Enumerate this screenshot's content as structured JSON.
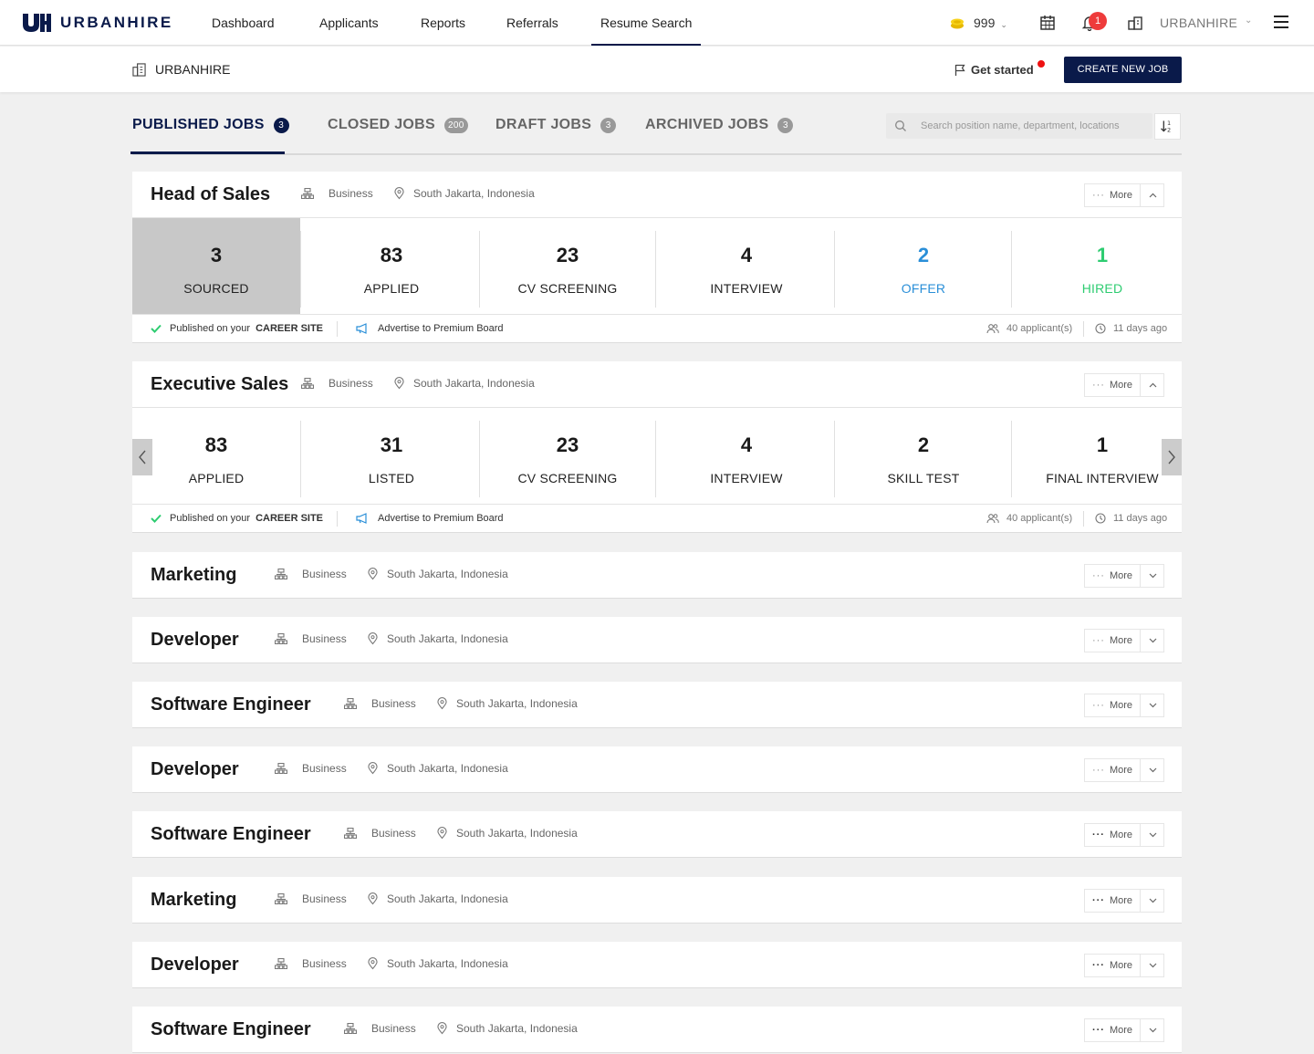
{
  "brand": {
    "name": "URBANHIRE",
    "accent": "#0a1a4a",
    "success": "#2ecc71",
    "offer": "#2a8fd8"
  },
  "nav": {
    "items": [
      {
        "label": "Dashboard"
      },
      {
        "label": "Applicants"
      },
      {
        "label": "Reports"
      },
      {
        "label": "Referrals"
      },
      {
        "label": "Resume Search"
      }
    ],
    "active": "Resume Search",
    "credits": "999",
    "notifications": "1",
    "company": "URBANHIRE"
  },
  "subheader": {
    "company": "URBANHIRE",
    "get_started": "Get started",
    "create_job": "CREATE NEW JOB"
  },
  "tabs": [
    {
      "label": "PUBLISHED JOBS",
      "count": "3"
    },
    {
      "label": "CLOSED JOBS",
      "count": "200"
    },
    {
      "label": "DRAFT JOBS",
      "count": "3"
    },
    {
      "label": "ARCHIVED JOBS",
      "count": "3"
    }
  ],
  "search": {
    "placeholder": "Search position name, department, locations",
    "value": ""
  },
  "footer_labels": {
    "published_on": "Published on your",
    "career_site": "CAREER SITE",
    "advertise": "Advertise to Premium Board"
  },
  "jobs": [
    {
      "title": "Head of Sales",
      "department": "Business",
      "location": "South Jakarta, Indonesia",
      "more": "More",
      "expanded": true,
      "stages": [
        {
          "count": "3",
          "label": "SOURCED"
        },
        {
          "count": "83",
          "label": "APPLIED"
        },
        {
          "count": "23",
          "label": "CV SCREENING"
        },
        {
          "count": "4",
          "label": "INTERVIEW"
        },
        {
          "count": "2",
          "label": "OFFER"
        },
        {
          "count": "1",
          "label": "HIRED"
        }
      ],
      "applicants": "40 applicant(s)",
      "posted": "11 days ago"
    },
    {
      "title": "Executive Sales",
      "department": "Business",
      "location": "South Jakarta, Indonesia",
      "more": "More",
      "expanded": true,
      "stages": [
        {
          "count": "83",
          "label": "APPLIED"
        },
        {
          "count": "31",
          "label": "LISTED"
        },
        {
          "count": "23",
          "label": "CV SCREENING"
        },
        {
          "count": "4",
          "label": "INTERVIEW"
        },
        {
          "count": "2",
          "label": "SKILL TEST"
        },
        {
          "count": "1",
          "label": "FINAL INTERVIEW"
        }
      ],
      "applicants": "40 applicant(s)",
      "posted": "11 days ago"
    },
    {
      "title": "Marketing",
      "department": "Business",
      "location": "South Jakarta, Indonesia",
      "more": "More"
    },
    {
      "title": "Developer",
      "department": "Business",
      "location": "South Jakarta, Indonesia",
      "more": "More"
    },
    {
      "title": "Software Engineer",
      "department": "Business",
      "location": "South Jakarta, Indonesia",
      "more": "More"
    },
    {
      "title": "Developer",
      "department": "Business",
      "location": "South Jakarta, Indonesia",
      "more": "More"
    },
    {
      "title": "Software Engineer",
      "department": "Business",
      "location": "South Jakarta, Indonesia",
      "more": "More"
    },
    {
      "title": "Marketing",
      "department": "Business",
      "location": "South Jakarta, Indonesia",
      "more": "More"
    },
    {
      "title": "Developer",
      "department": "Business",
      "location": "South Jakarta, Indonesia",
      "more": "More"
    },
    {
      "title": "Software Engineer",
      "department": "Business",
      "location": "South Jakarta, Indonesia",
      "more": "More"
    }
  ]
}
